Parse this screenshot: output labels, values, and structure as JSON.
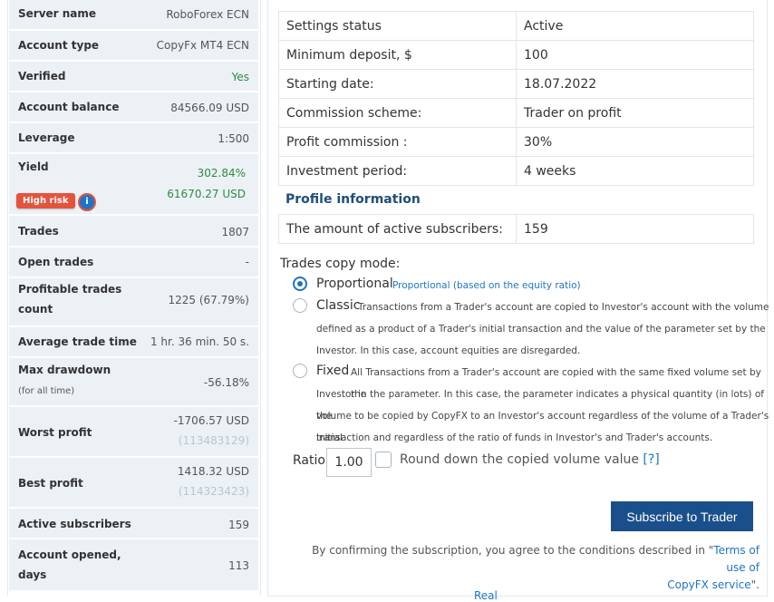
{
  "stats": [
    {
      "label": "Server name",
      "value": "RoboForex ECN"
    },
    {
      "label": "Account type",
      "value": "CopyFx MT4 ECN"
    },
    {
      "label": "Verified",
      "value": "Yes"
    },
    {
      "label": "Account balance",
      "value": "84566.09 USD"
    },
    {
      "label": "Leverage",
      "value": "1:500"
    },
    {
      "label": "Yield",
      "value": "302.84%",
      "value2": "61670.27 USD",
      "badge": "High risk"
    },
    {
      "label": "Trades",
      "value": "1807"
    },
    {
      "label": "Open trades",
      "value": "-"
    },
    {
      "label": "Profitable trades",
      "label2": "count",
      "value": "1225 (67.79%)"
    },
    {
      "label": "Average trade time",
      "value": "1 hr. 36 min. 50 s."
    },
    {
      "label": "Max drawdown",
      "note": "(for all time)",
      "value": "-56.18%"
    },
    {
      "label": "Worst profit",
      "value": "-1706.57 USD",
      "sub": "(113483129)"
    },
    {
      "label": "Best profit",
      "value": "1418.32 USD",
      "sub": "(114323423)"
    },
    {
      "label": "Active subscribers",
      "value": "159"
    },
    {
      "label": "Account opened,",
      "label2": "days",
      "value": "113"
    }
  ],
  "settings": [
    {
      "key": "Settings status",
      "value": "Active"
    },
    {
      "key": "Minimum deposit, $",
      "value": "100"
    },
    {
      "key": "Starting date:",
      "value": "18.07.2022"
    },
    {
      "key": "Commission scheme:",
      "value": "Trader on profit"
    },
    {
      "key": "Profit commission :",
      "value": "30%"
    },
    {
      "key": "Investment period:",
      "value": "4 weeks"
    }
  ],
  "profile_info_title": "Profile information",
  "subscribers": {
    "key": "The amount of active subscribers:",
    "value": "159"
  },
  "copy_mode": {
    "title": "Trades copy mode:",
    "options": [
      {
        "label": "Proportional",
        "desc_lines": [
          "Proportional (based on the equity ratio)"
        ],
        "checked": true
      },
      {
        "label": "Classic",
        "desc_lines": [
          "Transactions from a Trader's account are copied to Investor's account with the volume",
          "defined as a product of a Trader's initial transaction and the value of the parameter set by the",
          "Investor. In this case, account equities are disregarded."
        ],
        "checked": false
      },
      {
        "label": "Fixed",
        "desc_lines": [
          "All Transactions from a Trader's account are copied with the same fixed volume set by the",
          "Investor in the parameter. In this case, the parameter indicates a physical quantity (in lots) of the",
          "volume to be copied by CopyFX to an Investor's account regardless of the volume of a Trader's initial",
          "transaction and regardless of the ratio of funds in Investor's and Trader's accounts."
        ],
        "checked": false
      }
    ]
  },
  "ratio": {
    "label": "Ratio",
    "value": "1.00"
  },
  "round_down": {
    "label": "Round down the copied volume value",
    "help": "[?]"
  },
  "subscribe_button": "Subscribe to Trader",
  "consent": {
    "text": "By confirming the subscription, you agree to the conditions described in \"",
    "link1": "Terms of use of",
    "link2": "CopyFX service",
    "end": "\"."
  },
  "bottom_cut_text": "Real"
}
